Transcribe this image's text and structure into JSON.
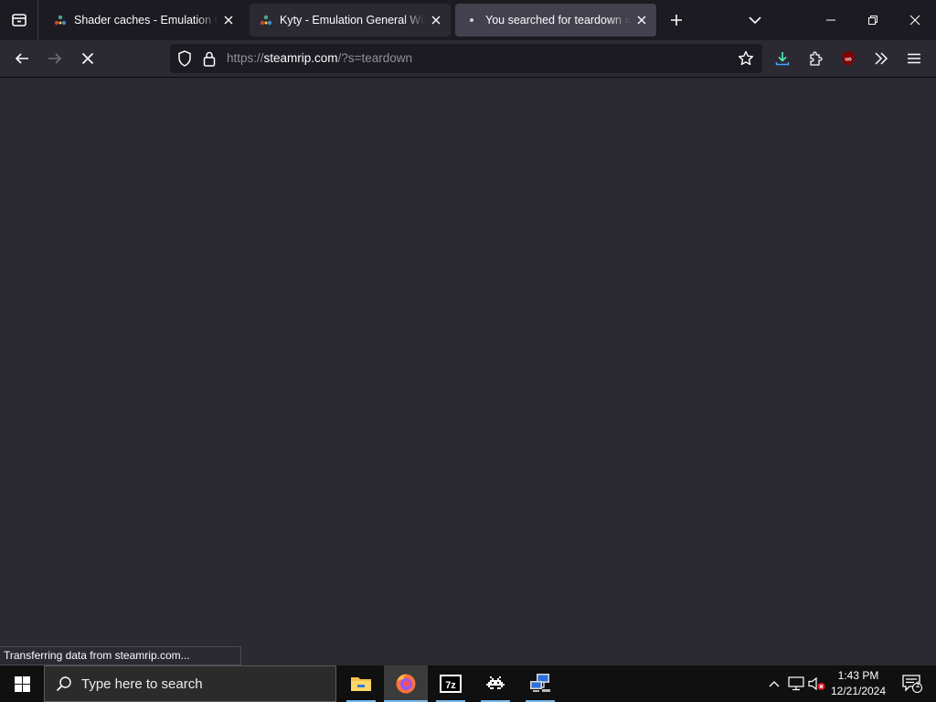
{
  "browser": {
    "tabs": [
      {
        "title": "Shader caches - Emulation General Wiki",
        "state": "inactive",
        "favicon": "wiki-icon"
      },
      {
        "title": "Kyty - Emulation General Wiki",
        "state": "inactive-hover",
        "favicon": "wiki-icon"
      },
      {
        "title": "You searched for teardown » SteamRIP",
        "state": "active-loading",
        "favicon": "loading-dot-icon"
      }
    ],
    "url": {
      "scheme": "https://",
      "domain": "steamrip.com",
      "path": "/?s=teardown"
    },
    "status_text": "Transferring data from steamrip.com..."
  },
  "colors": {
    "tab_strip_bg": "#1c1b22",
    "toolbar_bg": "#2b2a33",
    "active_tab_bg": "#42414d",
    "urlbar_bg": "#1c1b22",
    "download_accent": "#54ffbd",
    "ublock_red": "#800000",
    "taskbar_bg": "#101010"
  },
  "taskbar": {
    "search_placeholder": "Type here to search",
    "apps": [
      {
        "name": "file-explorer",
        "active": false
      },
      {
        "name": "firefox",
        "active": true
      },
      {
        "name": "7-zip",
        "active": false
      },
      {
        "name": "retroarch",
        "active": false
      },
      {
        "name": "network-app",
        "active": false
      }
    ],
    "clock": {
      "time": "1:43 PM",
      "date": "12/21/2024"
    },
    "notification_count": "1"
  }
}
